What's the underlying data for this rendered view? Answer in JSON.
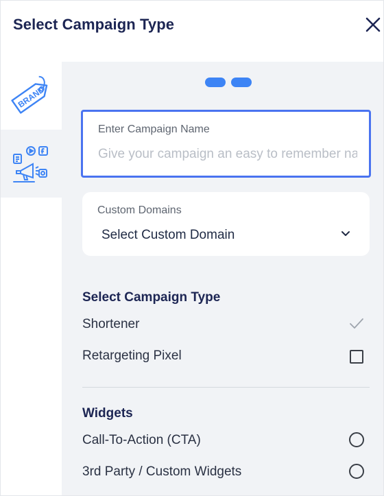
{
  "header": {
    "title": "Select Campaign Type",
    "close_icon": "close-icon"
  },
  "sidebar": {
    "items": [
      {
        "name": "brand",
        "icon": "brand-tag-icon",
        "active": false
      },
      {
        "name": "social",
        "icon": "social-media-icon",
        "active": true
      }
    ]
  },
  "colors": {
    "accent": "#3d84f5",
    "input_border": "#4a73f0",
    "title": "#1c2553",
    "panel_bg": "#f1f3f6"
  },
  "steps": {
    "count": 2
  },
  "campaign_name": {
    "label": "Enter Campaign Name",
    "value": "",
    "placeholder": "Give your campaign an easy to remember name"
  },
  "custom_domains": {
    "label": "Custom Domains",
    "selected": "Select Custom Domain",
    "icon": "chevron-down-icon"
  },
  "campaign_type": {
    "title": "Select Campaign Type",
    "options": [
      {
        "label": "Shortener",
        "control": "check",
        "checked": true
      },
      {
        "label": "Retargeting Pixel",
        "control": "checkbox",
        "checked": false
      }
    ]
  },
  "widgets": {
    "title": "Widgets",
    "options": [
      {
        "label": "Call-To-Action (CTA)",
        "control": "radio",
        "selected": false
      },
      {
        "label": "3rd Party / Custom Widgets",
        "control": "radio",
        "selected": false
      }
    ]
  }
}
